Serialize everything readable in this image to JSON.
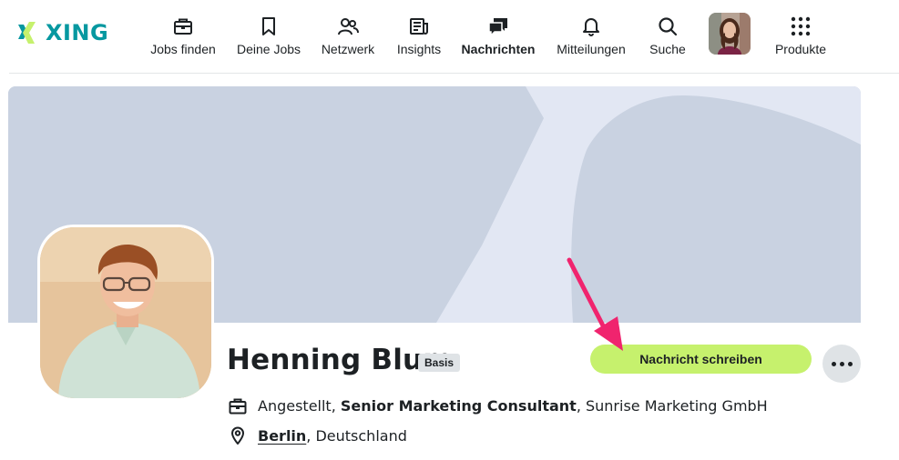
{
  "brand": {
    "name": "XING",
    "accent": "#0698a0",
    "logo_green": "#c6f16d"
  },
  "nav": {
    "items": [
      {
        "id": "jobs-finden",
        "label": "Jobs finden",
        "icon": "briefcase-icon"
      },
      {
        "id": "deine-jobs",
        "label": "Deine Jobs",
        "icon": "bookmark-icon"
      },
      {
        "id": "netzwerk",
        "label": "Netzwerk",
        "icon": "people-icon"
      },
      {
        "id": "insights",
        "label": "Insights",
        "icon": "newspaper-icon"
      },
      {
        "id": "nachrichten",
        "label": "Nachrichten",
        "icon": "chat-bubbles-icon",
        "active": true
      },
      {
        "id": "mitteilungen",
        "label": "Mitteilungen",
        "icon": "bell-icon"
      },
      {
        "id": "suche",
        "label": "Suche",
        "icon": "search-icon"
      },
      {
        "id": "produkte",
        "label": "Produkte",
        "icon": "grid-dots-icon"
      }
    ]
  },
  "profile": {
    "name": "Henning Blum",
    "membership_badge": "Basis",
    "employment_status": "Angestellt",
    "separator": ", ",
    "job_title": "Senior Marketing Consultant",
    "company": "Sunrise Marketing GmbH",
    "city": "Berlin",
    "country": "Deutschland"
  },
  "actions": {
    "message_button": "Nachricht schreiben",
    "more_button_icon": "more-horizontal-icon"
  },
  "colors": {
    "cta": "#c6f16d",
    "banner": "#c9d2e1",
    "banner_light": "#e2e7f3",
    "annotation_arrow": "#f0246e"
  }
}
